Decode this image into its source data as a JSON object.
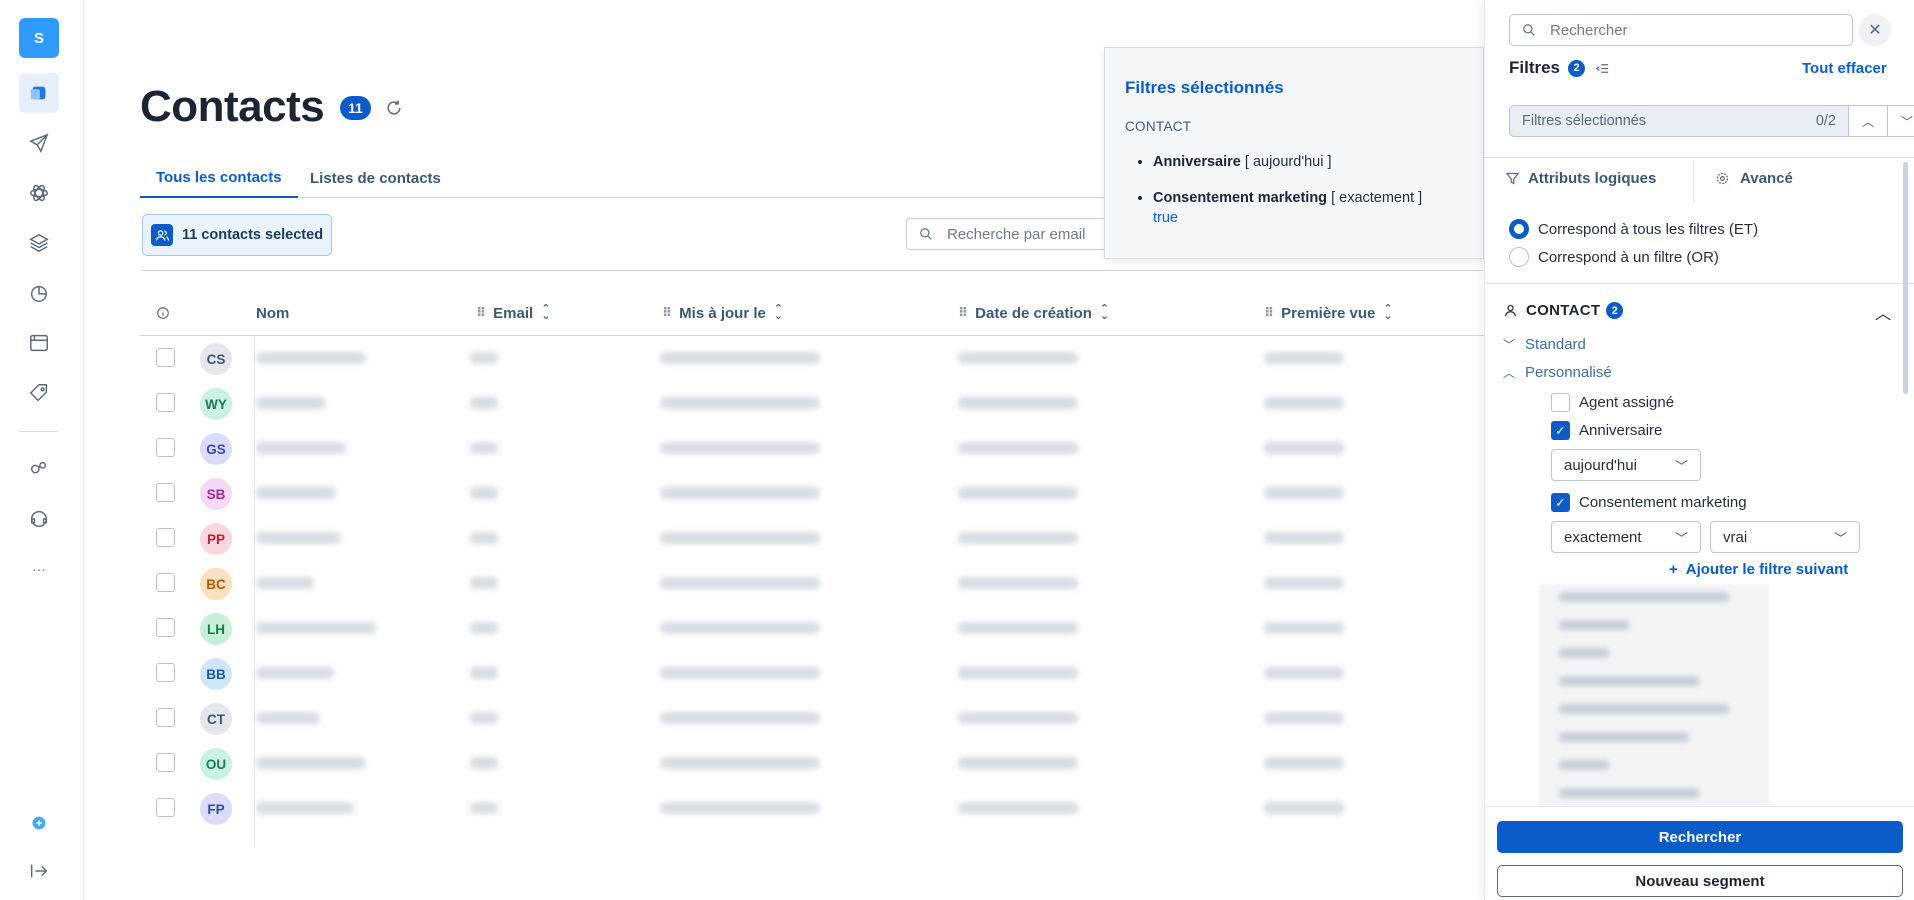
{
  "sidebar": {
    "logo_letter": "S",
    "items": [
      {
        "name": "dashboard-icon"
      },
      {
        "name": "send-icon"
      },
      {
        "name": "atom-icon"
      },
      {
        "name": "layers-icon"
      },
      {
        "name": "pie-icon"
      },
      {
        "name": "window-icon"
      },
      {
        "name": "tag-icon"
      },
      {
        "name": "integrations-icon"
      },
      {
        "name": "support-icon"
      },
      {
        "name": "more-icon",
        "label": "···"
      }
    ]
  },
  "header": {
    "title": "Contacts",
    "count": "11"
  },
  "tabs": [
    {
      "label": "Tous les contacts"
    },
    {
      "label": "Listes de contacts"
    }
  ],
  "selection": {
    "label": "11 contacts selected"
  },
  "email_search": {
    "placeholder": "Recherche par email"
  },
  "table": {
    "columns": [
      "Nom",
      "Email",
      "Mis à jour le",
      "Date de création",
      "Première vue"
    ],
    "rows": [
      {
        "initials": "CS",
        "bg": "#e3e7ec",
        "fg": "#3e5874"
      },
      {
        "initials": "WY",
        "bg": "#c9f2e3",
        "fg": "#1b7a57"
      },
      {
        "initials": "GS",
        "bg": "#d9dcfb",
        "fg": "#3b47a8"
      },
      {
        "initials": "SB",
        "bg": "#f5d9f5",
        "fg": "#9a2c9a"
      },
      {
        "initials": "PP",
        "bg": "#fbd6da",
        "fg": "#b32435"
      },
      {
        "initials": "BC",
        "bg": "#fde0bf",
        "fg": "#b35a00"
      },
      {
        "initials": "LH",
        "bg": "#c8f0d8",
        "fg": "#1e7a45"
      },
      {
        "initials": "BB",
        "bg": "#cfe6fb",
        "fg": "#1c5a9c"
      },
      {
        "initials": "CT",
        "bg": "#e3e7ec",
        "fg": "#3e5874"
      },
      {
        "initials": "OU",
        "bg": "#c9f2e3",
        "fg": "#1b7a57"
      },
      {
        "initials": "FP",
        "bg": "#d9dcfb",
        "fg": "#3b47a8"
      }
    ]
  },
  "popover": {
    "title": "Filtres sélectionnés",
    "section": "CONTACT",
    "items": [
      {
        "name": "Anniversaire",
        "op": "[ aujourd'hui ]",
        "value": ""
      },
      {
        "name": "Consentement marketing",
        "op": "[ exactement ]",
        "value": "true"
      }
    ]
  },
  "panel": {
    "search_placeholder": "Rechercher",
    "filters_label": "Filtres",
    "filters_count": "2",
    "clear_all": "Tout effacer",
    "selected_label": "Filtres sélectionnés",
    "selected_counter": "0/2",
    "tab_logic": "Attributs logiques",
    "tab_advanced": "Avancé",
    "radio_all": "Correspond à tous les filtres (ET)",
    "radio_any": "Correspond à un filtre (OR)",
    "contact_label": "CONTACT",
    "contact_count": "2",
    "standard": "Standard",
    "custom": "Personnalisé",
    "agent": "Agent assigné",
    "birthday": "Anniversaire",
    "birthday_op": "aujourd'hui",
    "consent": "Consentement marketing",
    "consent_op": "exactement",
    "consent_value": "vrai",
    "add_next": "Ajouter le filtre suivant",
    "search_button": "Rechercher",
    "new_segment": "Nouveau segment"
  }
}
